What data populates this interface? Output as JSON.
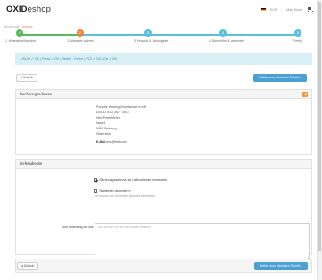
{
  "header": {
    "logo_bold": "OXID",
    "logo_rest": "eshop",
    "lang": "EUR",
    "account": "Mein Konto"
  },
  "breadcrumb": {
    "home": "Sie sind hier:",
    "current": "Adresse"
  },
  "steps": [
    {
      "num": "✓",
      "label": "1. Warenkorbübersicht",
      "color": "#5cb85c"
    },
    {
      "num": "2",
      "label": "2. Adressen wählen",
      "color": "#f0833a"
    },
    {
      "num": "3",
      "label": "3. Versand & Zahlungsart",
      "color": "#5bc0de"
    },
    {
      "num": "4",
      "label": "4. Überprüfen & absenden",
      "color": "#5bc0de"
    },
    {
      "num": "5",
      "label": "Fertig!",
      "color": "#5bc0de"
    }
  ],
  "status_text": "USt-ID ✓ OK | Firma ✓ OK | Straße - Fehler | PLZ ✓ OK | Ort ✓ OK",
  "buttons": {
    "back": "◂ Zurück",
    "next": "Weiter zum nächsten Schritt ▸"
  },
  "billing": {
    "title": "Rechnungsadresse",
    "lines": [
      "Porsche Holding Gesellschaft m.b.H",
      "USt-ID: ATU 3677 3918",
      "Herr Peter Meier",
      "Natz 3",
      "5020 Salzburg",
      "Österreich"
    ],
    "email_label": "E-Mail",
    "email_value": "test@test.com"
  },
  "shipping": {
    "title": "Lieferadresse",
    "use_billing": "Rechnungsadresse als Lieferadresse verwenden",
    "newsletter": "Newsletter abonnieren",
    "newsletter_hint": "Sie können den Newsletter jederzeit abbestellen",
    "message_label": "Ihre Mitteilung an uns",
    "message_placeholder": "Hier können Sie uns noch etwas mitteilen."
  }
}
